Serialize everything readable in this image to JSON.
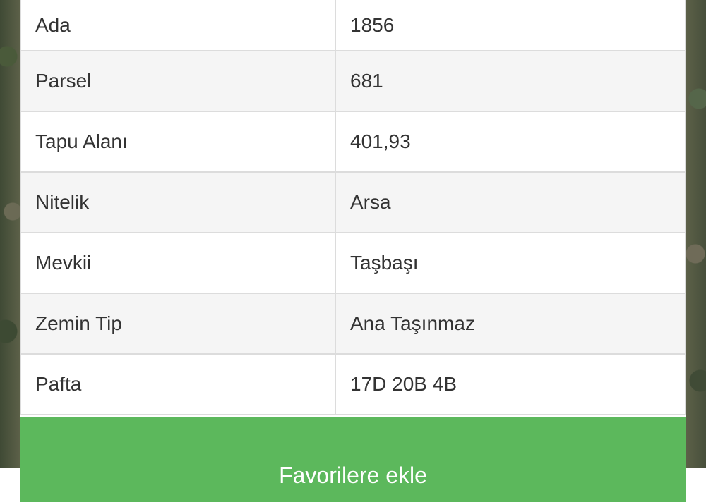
{
  "parcel_info": {
    "rows": [
      {
        "label": "Ada",
        "value": "1856"
      },
      {
        "label": "Parsel",
        "value": "681"
      },
      {
        "label": "Tapu Alanı",
        "value": "401,93"
      },
      {
        "label": "Nitelik",
        "value": "Arsa"
      },
      {
        "label": "Mevkii",
        "value": "Taşbaşı"
      },
      {
        "label": "Zemin Tip",
        "value": "Ana Taşınmaz"
      },
      {
        "label": "Pafta",
        "value": "17D 20B 4B"
      }
    ]
  },
  "actions": {
    "favorite_label": "Favorilere ekle"
  },
  "colors": {
    "button_green": "#5cb85c",
    "border": "#dcdcdc",
    "stripe": "#f5f5f5"
  }
}
